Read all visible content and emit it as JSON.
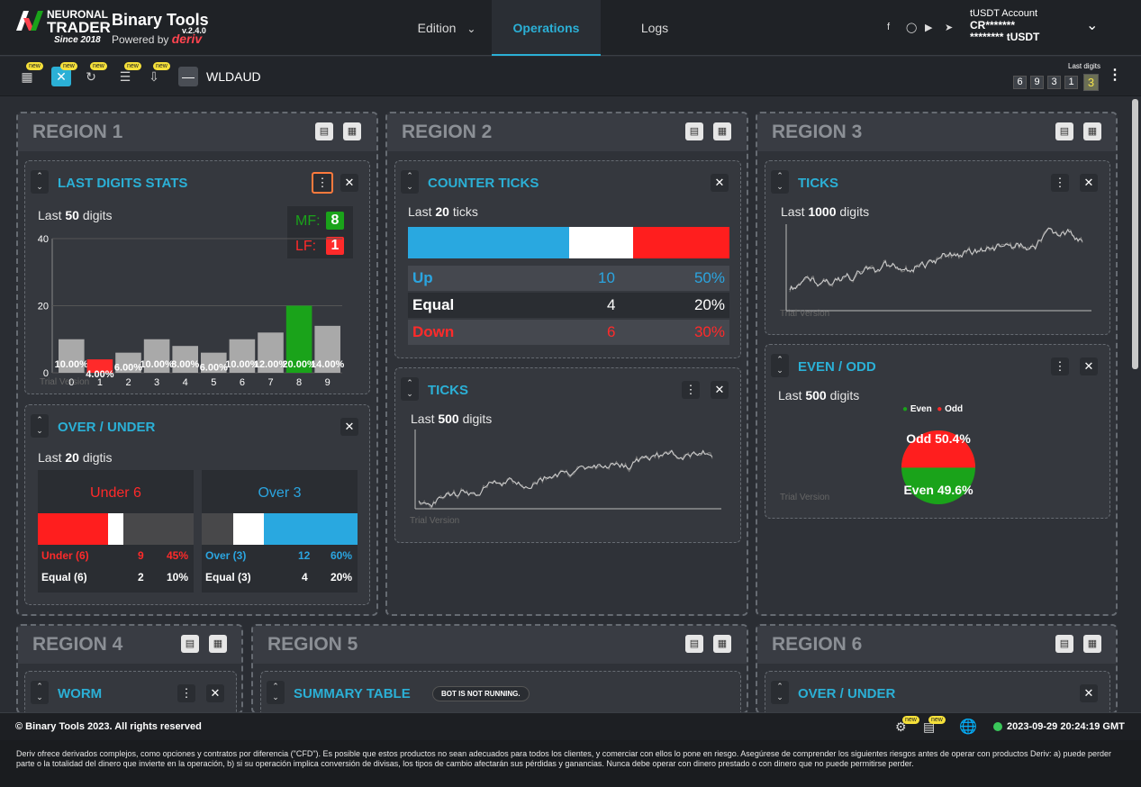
{
  "header": {
    "brand_top": "NEURONAL",
    "brand_mid": "TRADER",
    "brand_since": "Since 2018",
    "app_name": "Binary Tools",
    "version": "v.2.4.0",
    "powered_by": "Powered by",
    "powered_brand": "deriv",
    "nav": [
      {
        "label": "Edition"
      },
      {
        "label": "Operations"
      },
      {
        "label": "Logs"
      }
    ],
    "account": {
      "title": "tUSDT Account",
      "id": "CR*******",
      "balance": "******** tUSDT"
    },
    "social_icons": [
      "facebook-icon",
      "instagram-icon",
      "youtube-icon",
      "telegram-icon"
    ]
  },
  "toolbar": {
    "new_badge": "new",
    "symbol": "WLDAUD",
    "last_digits_title": "Last digits",
    "last_digits": [
      "6",
      "9",
      "3",
      "1"
    ],
    "last_digit_current": "3"
  },
  "regions": {
    "r1": "REGION 1",
    "r2": "REGION 2",
    "r3": "REGION 3",
    "r4": "REGION 4",
    "r5": "REGION 5",
    "r6": "REGION 6"
  },
  "last_digits_stats": {
    "title": "LAST DIGITS STATS",
    "sub_prefix": "Last",
    "sub_count": "50",
    "sub_suffix": "digits",
    "mf_label": "MF:",
    "mf_value": "8",
    "lf_label": "LF:",
    "lf_value": "1",
    "trial": "Trial Version"
  },
  "chart_data": {
    "type": "bar",
    "categories": [
      "0",
      "1",
      "2",
      "3",
      "4",
      "5",
      "6",
      "7",
      "8",
      "9"
    ],
    "values": [
      10,
      4,
      6,
      10,
      8,
      6,
      10,
      12,
      20,
      14
    ],
    "labels": [
      "10.00%",
      "4.00%",
      "6.00%",
      "10.00%",
      "8.00%",
      "6.00%",
      "10.00%",
      "12.00%",
      "20.00%",
      "14.00%"
    ],
    "yticks": [
      "0",
      "20",
      "40"
    ],
    "ylim": [
      0,
      40
    ],
    "colors": {
      "default": "#a9a9a9",
      "max": "#1aa31a",
      "min": "#ff2a2a"
    }
  },
  "over_under_1": {
    "title": "OVER / UNDER",
    "sub_prefix": "Last",
    "sub_count": "20",
    "sub_suffix": "digtis",
    "under": {
      "head": "Under 6",
      "row1": [
        "Under (6)",
        "9",
        "45%"
      ],
      "row2": [
        "Equal (6)",
        "2",
        "10%"
      ]
    },
    "over": {
      "head": "Over 3",
      "row1": [
        "Over (3)",
        "12",
        "60%"
      ],
      "row2": [
        "Equal (3)",
        "4",
        "20%"
      ]
    },
    "under_fraction": 0.45,
    "under_equal_fraction": 0.1,
    "over_fraction": 0.6,
    "over_equal_fraction": 0.2
  },
  "counter_ticks": {
    "title": "COUNTER TICKS",
    "sub_prefix": "Last",
    "sub_count": "20",
    "sub_suffix": "ticks",
    "rows": [
      {
        "label": "Up",
        "count": "10",
        "pct": "50%"
      },
      {
        "label": "Equal",
        "count": "4",
        "pct": "20%"
      },
      {
        "label": "Down",
        "count": "6",
        "pct": "30%"
      }
    ],
    "fractions": [
      0.5,
      0.2,
      0.3
    ]
  },
  "ticks_r2": {
    "title": "TICKS",
    "sub_prefix": "Last",
    "sub_count": "500",
    "sub_suffix": "digits",
    "trial": "Trial Version"
  },
  "ticks_r3": {
    "title": "TICKS",
    "sub_prefix": "Last",
    "sub_count": "1000",
    "sub_suffix": "digits",
    "trial": "Trial Version"
  },
  "even_odd": {
    "title": "EVEN / ODD",
    "sub_prefix": "Last",
    "sub_count": "500",
    "sub_suffix": "digits",
    "legend_even": "Even",
    "legend_odd": "Odd",
    "odd_label": "Odd 50.4%",
    "even_label": "Even 49.6%",
    "odd_pct": 50.4,
    "even_pct": 49.6,
    "trial": "Trial Version"
  },
  "worm": {
    "title": "WORM"
  },
  "summary": {
    "title": "SUMMARY TABLE",
    "badge": "BOT IS NOT RUNNING."
  },
  "over_under_2": {
    "title": "OVER / UNDER"
  },
  "footer": {
    "copyright": "© Binary Tools 2023. All rights reserved",
    "datetime": "2023-09-29 20:24:19 GMT",
    "disclaimer": "Deriv ofrece derivados complejos, como opciones y contratos por diferencia (\"CFD\"). Es posible que estos productos no sean adecuados para todos los clientes, y comerciar con ellos lo pone en riesgo. Asegúrese de comprender los siguientes riesgos antes de operar con productos Deriv: a) puede perder parte o la totalidad del dinero que invierte en la operación, b) si su operación implica conversión de divisas, los tipos de cambio afectarán sus pérdidas y ganancias. Nunca debe operar con dinero prestado o con dinero que no puede permitirse perder."
  }
}
